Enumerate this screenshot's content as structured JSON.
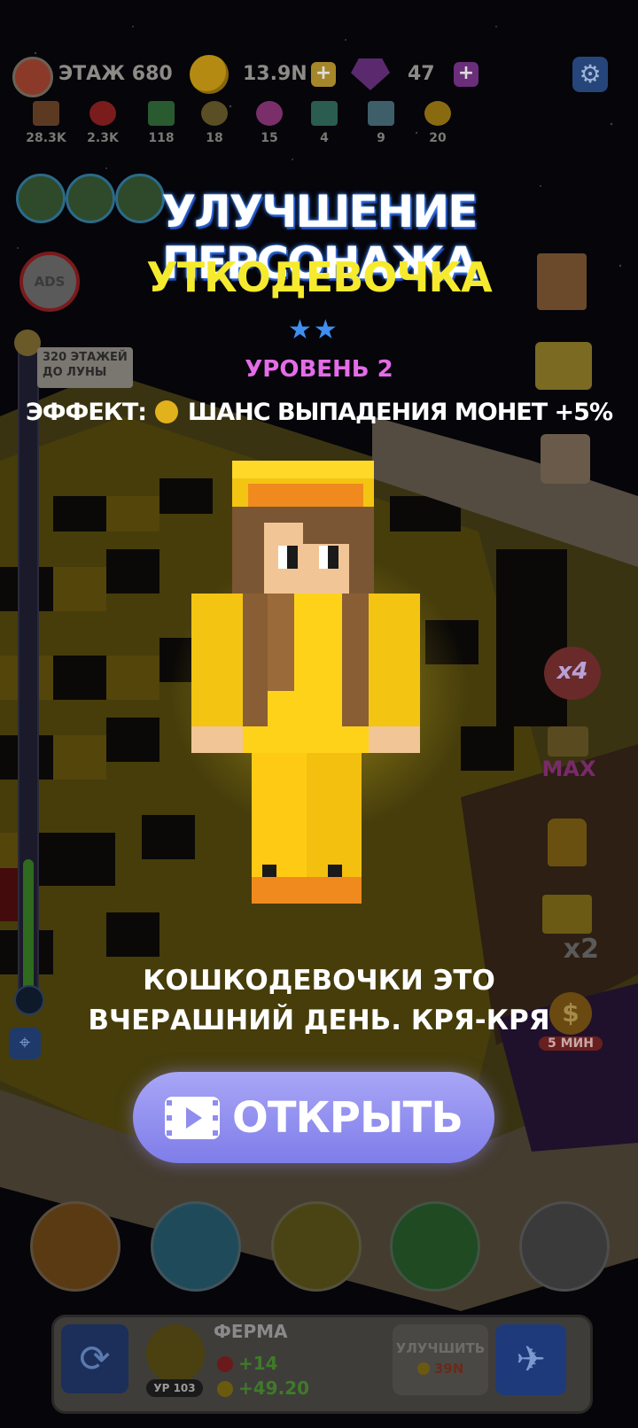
{
  "hud": {
    "floor_label": "ЭТАЖ 680",
    "coins": "13.9N",
    "gems": "47",
    "resources": [
      {
        "icon": "chest-icon",
        "value": "28.3K",
        "color": "#6b3a1f"
      },
      {
        "icon": "strawberry-icon",
        "value": "2.3K",
        "color": "#8a1d1d"
      },
      {
        "icon": "book-icon",
        "value": "118",
        "color": "#2f6b33"
      },
      {
        "icon": "donut-icon",
        "value": "18",
        "color": "#6a5b2a"
      },
      {
        "icon": "candy-icon",
        "value": "15",
        "color": "#8a3b7a"
      },
      {
        "icon": "banknote-icon",
        "value": "4",
        "color": "#2e6a5a"
      },
      {
        "icon": "potion-icon",
        "value": "9",
        "color": "#4a6e7a"
      },
      {
        "icon": "sunflower-icon",
        "value": "20",
        "color": "#9a7b14"
      }
    ]
  },
  "sidebar": {
    "no_ads": "ADS",
    "progress_label_line1": "320 ЭТАЖЕЙ",
    "progress_label_line2": "ДО ЛУНЫ",
    "right_badges": {
      "x4": "x4",
      "max": "MAX",
      "x2": "x2",
      "timer": "5 МИН"
    }
  },
  "modal": {
    "title": "УЛУЧШЕНИЕ ПЕРСОНАЖА",
    "character_name": "УТКОДЕВОЧКА",
    "stars": "★★",
    "level": "УРОВЕНЬ 2",
    "effect_prefix": "ЭФФЕКТ:",
    "effect_text": "ШАНС ВЫПАДЕНИЯ МОНЕТ +5%",
    "description_line1": "КОШКОДЕВОЧКИ ЭТО",
    "description_line2": "ВЧЕРАШНИЙ ДЕНЬ. КРЯ-КРЯ",
    "open_button": "ОТКРЫТЬ"
  },
  "bottom_panel": {
    "building_name": "ФЕРМА",
    "level_badge": "УР 103",
    "stat1": "+14",
    "stat2": "+49.20",
    "upgrade_label": "УЛУЧШИТЬ",
    "upgrade_cost": "39N"
  },
  "colors": {
    "title_yellow": "#f6ea2e",
    "level_pink": "#e46ce8",
    "button_purple": "#8f8dee",
    "star_blue": "#3f8ff2"
  }
}
